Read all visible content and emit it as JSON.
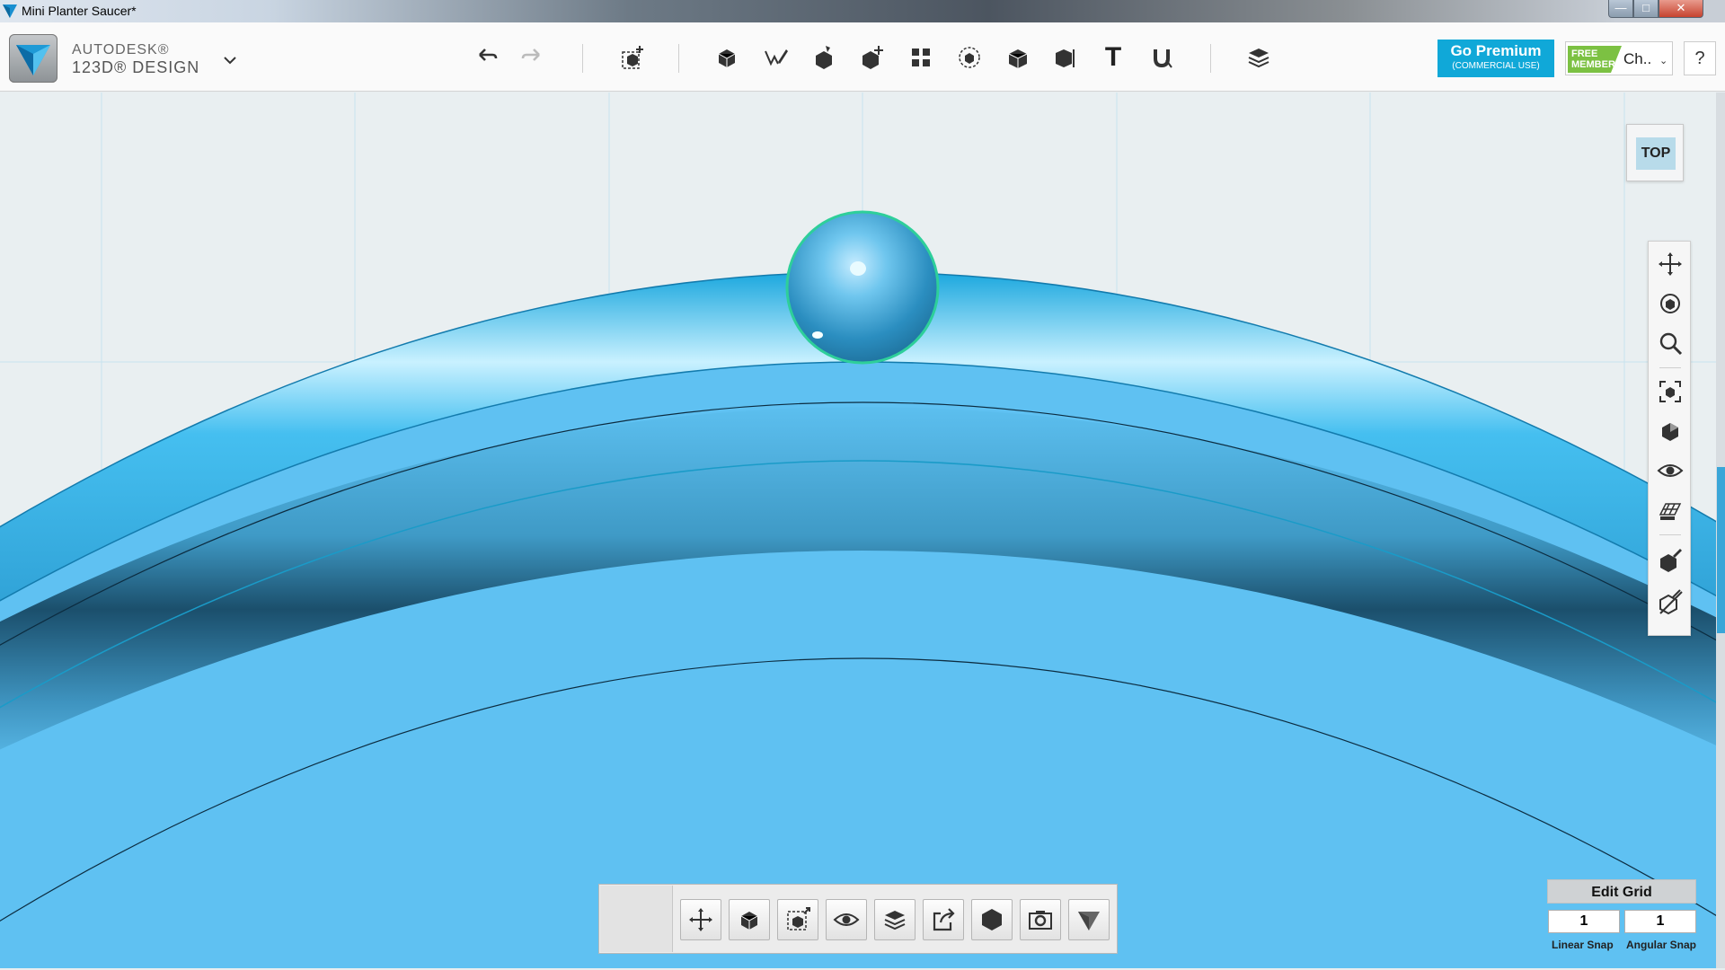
{
  "window": {
    "title": "Mini Planter Saucer*",
    "controls": [
      "minimize",
      "maximize",
      "close"
    ]
  },
  "brand": {
    "line1": "AUTODESK®",
    "line2": "123D® DESIGN",
    "menu_icon": "chevron-down-icon"
  },
  "toolbar": {
    "left_group": [
      "undo-icon",
      "redo-icon"
    ],
    "tools": [
      "transform-icon",
      "primitives-icon",
      "sketch-icon",
      "construct-icon",
      "modify-icon",
      "pattern-icon",
      "grouping-icon",
      "combine-icon",
      "measure-icon",
      "text-icon",
      "snap-icon",
      "materials-icon"
    ],
    "text_tool_glyph": "T"
  },
  "account": {
    "premium_main": "Go Premium",
    "premium_sub": "(COMMERCIAL USE)",
    "badge_line1": "FREE",
    "badge_line2": "MEMBER",
    "user": "Ch..",
    "help": "?"
  },
  "viewcube": {
    "face": "TOP"
  },
  "navbar": {
    "icons": [
      "pan-icon",
      "orbit-icon",
      "zoom-icon",
      "fit-icon",
      "perspective-icon",
      "visibility-icon",
      "grid-icon",
      "material-edit-icon",
      "outline-icon"
    ]
  },
  "bottom_toolbar": {
    "icons": [
      "move-icon",
      "box-select-icon",
      "focus-icon",
      "hide-icon",
      "layers-icon",
      "export-icon",
      "solid-icon",
      "camera-icon",
      "brand-icon"
    ]
  },
  "grid": {
    "title": "Edit Grid",
    "linear_value": "1",
    "angular_value": "1",
    "linear_label": "Linear Snap",
    "angular_label": "Angular Snap"
  },
  "colors": {
    "model_blue": "#5cbfef",
    "accent": "#10a8d8",
    "member_green": "#7cc142",
    "selection": "#2ecf9a"
  }
}
